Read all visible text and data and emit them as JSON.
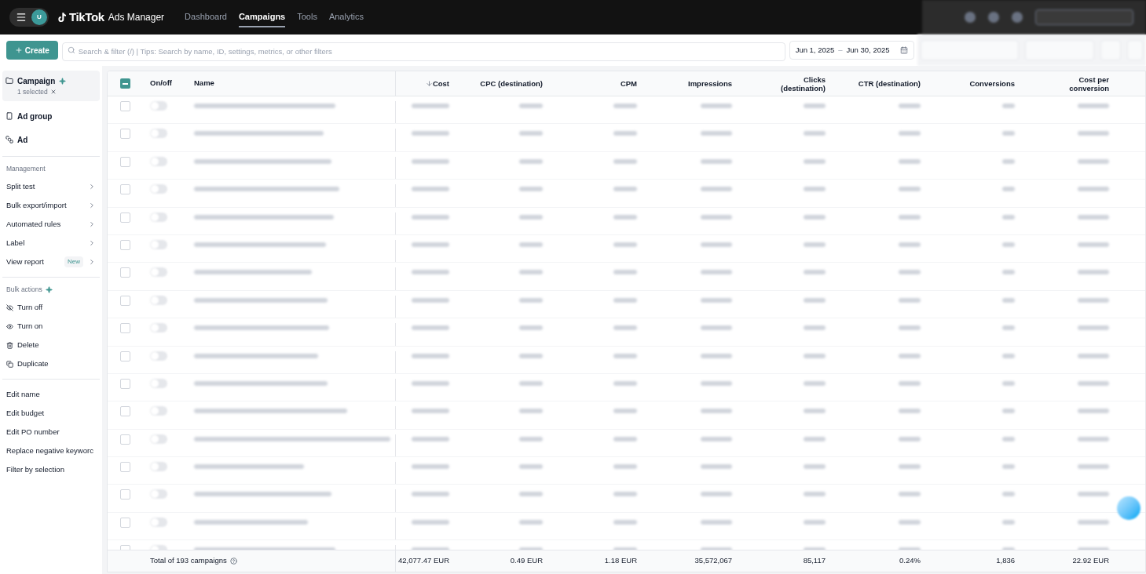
{
  "topbar": {
    "avatar": "U",
    "logo": "TikTok",
    "product": "Ads Manager",
    "nav": [
      {
        "label": "Dashboard",
        "selected": false
      },
      {
        "label": "Campaigns",
        "selected": true
      },
      {
        "label": "Tools",
        "selected": false
      },
      {
        "label": "Analytics",
        "selected": false
      }
    ]
  },
  "toolbar": {
    "create": "Create",
    "search_placeholder": "Search & filter (/) | Tips: Search by name, ID, settings, metrics, or other filters",
    "date_from": "Jun 1, 2025",
    "date_sep": "–",
    "date_to": "Jun 30, 2025"
  },
  "sidebar": {
    "levels": [
      {
        "label": "Campaign",
        "selected": true,
        "note": "1 selected"
      },
      {
        "label": "Ad group",
        "selected": false
      },
      {
        "label": "Ad",
        "selected": false
      }
    ],
    "sections": [
      {
        "title": "Management",
        "sparkle": false,
        "items": [
          {
            "label": "Split test",
            "kind": "submenu"
          },
          {
            "label": "Bulk export/import",
            "kind": "submenu"
          },
          {
            "label": "Automated rules",
            "kind": "submenu"
          },
          {
            "label": "Label",
            "kind": "submenu"
          },
          {
            "label": "View report",
            "kind": "submenu",
            "badge": "New"
          }
        ]
      },
      {
        "title": "Bulk actions",
        "sparkle": true,
        "items": [
          {
            "label": "Turn off",
            "kind": "action"
          },
          {
            "label": "Turn on",
            "kind": "action"
          },
          {
            "label": "Delete",
            "kind": "action"
          },
          {
            "label": "Duplicate",
            "kind": "action"
          }
        ]
      },
      {
        "items": [
          {
            "label": "Edit name",
            "kind": "plain"
          },
          {
            "label": "Edit budget",
            "kind": "plain"
          },
          {
            "label": "Edit PO number",
            "kind": "plain"
          },
          {
            "label": "Replace negative keyworc",
            "kind": "plain"
          },
          {
            "label": "Filter by selection",
            "kind": "plain"
          }
        ]
      }
    ]
  },
  "table": {
    "header_checkbox": {
      "partial": true
    },
    "columns": [
      {
        "label": "On/off"
      },
      {
        "label": "Name"
      },
      {
        "label": "Cost",
        "sorted": true
      },
      {
        "label": "CPC (destination)",
        "sorted": false
      },
      {
        "label": "CPM",
        "sorted": false
      },
      {
        "label": "Impressions",
        "sorted": false
      },
      {
        "label": "Clicks (destination)",
        "sorted": false
      },
      {
        "label": "CTR (destination)",
        "sorted": false
      },
      {
        "label": "Conversions",
        "sorted": false
      },
      {
        "label": "Cost per conversion",
        "sorted": false
      }
    ],
    "rows": [
      {
        "checked": false,
        "on": false
      },
      {
        "checked": false,
        "on": false
      },
      {
        "checked": false,
        "on": false
      },
      {
        "checked": false,
        "on": false
      },
      {
        "checked": false,
        "on": false
      },
      {
        "checked": false,
        "on": false
      },
      {
        "checked": false,
        "on": false
      },
      {
        "checked": false,
        "on": false
      },
      {
        "checked": false,
        "on": false
      },
      {
        "checked": false,
        "on": false
      },
      {
        "checked": false,
        "on": false
      },
      {
        "checked": false,
        "on": false
      },
      {
        "checked": false,
        "on": false
      },
      {
        "checked": false,
        "on": false
      },
      {
        "checked": false,
        "on": false
      },
      {
        "checked": false,
        "on": false
      },
      {
        "checked": false,
        "on": false
      }
    ],
    "footer": {
      "label": "Total of 193 campaigns",
      "values": [
        "42,077.47 EUR",
        "0.49 EUR",
        "1.18 EUR",
        "35,572,067",
        "85,117",
        "0.24%",
        "1,836",
        "22.92 EUR"
      ]
    }
  }
}
